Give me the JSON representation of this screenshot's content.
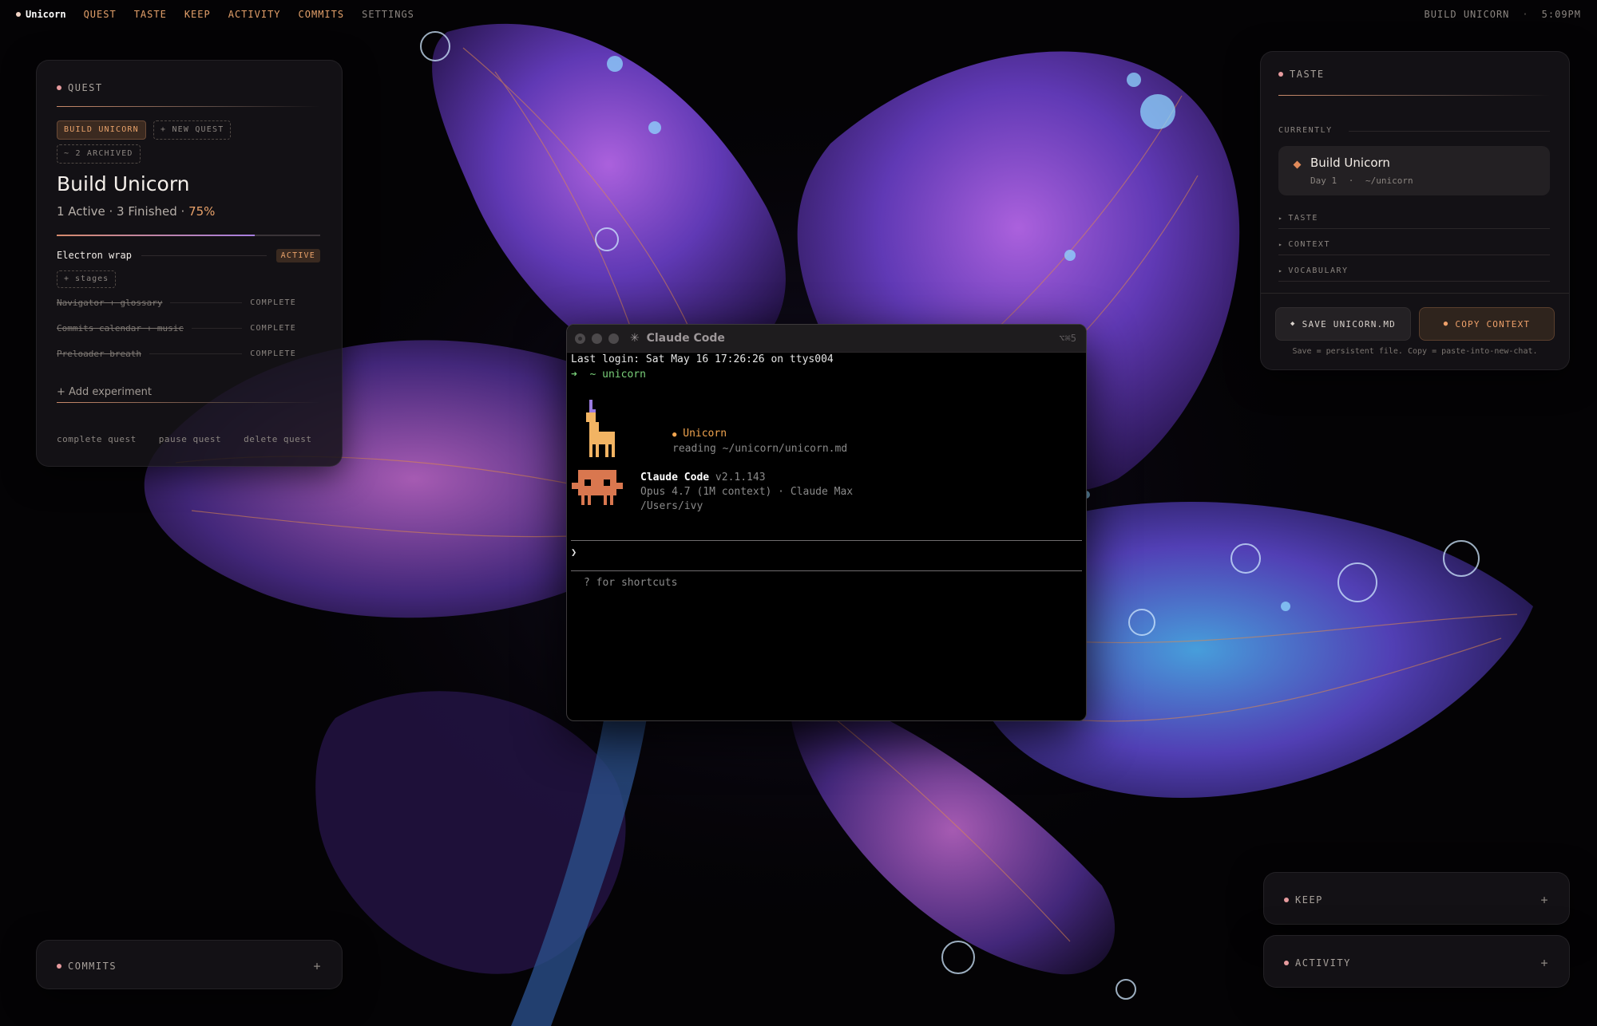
{
  "topbar": {
    "brand": "Unicorn",
    "nav": [
      "QUEST",
      "TASTE",
      "KEEP",
      "ACTIVITY",
      "COMMITS",
      "SETTINGS"
    ],
    "right_title": "BUILD UNICORN",
    "separator": "·",
    "time": "5:09PM"
  },
  "quest": {
    "header": "QUEST",
    "chip_active": "BUILD UNICORN",
    "chip_new": "+ NEW QUEST",
    "chip_archived": "~ 2 ARCHIVED",
    "title": "Build Unicorn",
    "summary": "1 Active · 3 Finished ·",
    "percent_label": "75%",
    "progress_fraction": 0.75,
    "active_item": {
      "label": "Electron wrap",
      "status": "ACTIVE"
    },
    "stages_chip": "+ stages",
    "completed": [
      {
        "label": "Navigator + glossary",
        "status": "COMPLETE"
      },
      {
        "label": "Commits calendar + music",
        "status": "COMPLETE"
      },
      {
        "label": "Preloader breath",
        "status": "COMPLETE"
      }
    ],
    "add_experiment": "+ Add experiment",
    "actions": [
      "complete quest",
      "pause quest",
      "delete quest"
    ]
  },
  "taste": {
    "header": "TASTE",
    "currently_label": "CURRENTLY",
    "current_title": "Build Unicorn",
    "current_day": "Day 1",
    "current_sep": "·",
    "current_path": "~/unicorn",
    "sections": [
      "TASTE",
      "CONTEXT",
      "VOCABULARY"
    ],
    "save_button": "SAVE UNICORN.MD",
    "copy_button": "COPY CONTEXT",
    "note": "Save = persistent file. Copy = paste-into-new-chat."
  },
  "commits": {
    "header": "COMMITS",
    "plus": "+"
  },
  "keep": {
    "header": "KEEP",
    "plus": "+"
  },
  "activity": {
    "header": "ACTIVITY",
    "plus": "+"
  },
  "terminal": {
    "title": "Claude Code",
    "title_star": "✳",
    "shortcut": "⌥⌘5",
    "last_login": "Last login: Sat May 16 17:26:26 on ttys004",
    "prompt_arrow": "➜",
    "prompt_tilde": "~",
    "prompt_dir": "unicorn",
    "unicorn_name": "Unicorn",
    "unicorn_dot": "●",
    "unicorn_reading": "reading ~/unicorn/unicorn.md",
    "app_name": "Claude Code",
    "app_version": "v2.1.143",
    "model_line": "Opus 4.7 (1M context) · Claude Max",
    "cwd": "/Users/ivy",
    "input_caret": "❯",
    "hint": "? for shortcuts"
  },
  "colors": {
    "accent_orange": "#e9a26a",
    "dot_pink": "#e79b9e",
    "terminal_green": "#7ad07a",
    "terminal_orange": "#f0a44f",
    "claude_mascot": "#d9774f",
    "unicorn_body": "#f2b463",
    "unicorn_horn": "#9a7be0"
  }
}
